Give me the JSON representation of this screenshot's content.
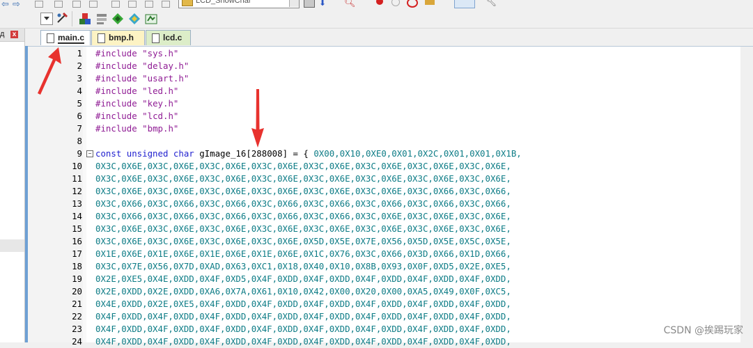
{
  "toolbar": {
    "target_name": "LCD_ShowChar"
  },
  "left_panel": {
    "title": "д",
    "close_glyph": "x"
  },
  "tabs": [
    {
      "label": "main.c"
    },
    {
      "label": "bmp.h"
    },
    {
      "label": "lcd.c"
    }
  ],
  "editor": {
    "lines": [
      {
        "n": "1",
        "pre": "#include",
        "str": "\"sys.h\""
      },
      {
        "n": "2",
        "pre": "#include",
        "str": "\"delay.h\""
      },
      {
        "n": "3",
        "pre": "#include",
        "str": "\"usart.h\""
      },
      {
        "n": "4",
        "pre": "#include",
        "str": "\"led.h\""
      },
      {
        "n": "5",
        "pre": "#include",
        "str": "\"key.h\""
      },
      {
        "n": "6",
        "pre": "#include",
        "str": "\"lcd.h\""
      },
      {
        "n": "7",
        "pre": "#include",
        "str": "\"bmp.h\""
      },
      {
        "n": "8"
      },
      {
        "n": "9",
        "kw": "const unsigned char",
        "decl": "gImage_16[288008] = {",
        "hex": "0X00,0X10,0XE0,0X01,0X2C,0X01,0X01,0X1B,"
      },
      {
        "n": "10",
        "hex": "0X3C,0X6E,0X3C,0X6E,0X3C,0X6E,0X3C,0X6E,0X3C,0X6E,0X3C,0X6E,0X3C,0X6E,0X3C,0X6E,"
      },
      {
        "n": "11",
        "hex": "0X3C,0X6E,0X3C,0X6E,0X3C,0X6E,0X3C,0X6E,0X3C,0X6E,0X3C,0X6E,0X3C,0X6E,0X3C,0X6E,"
      },
      {
        "n": "12",
        "hex": "0X3C,0X6E,0X3C,0X6E,0X3C,0X6E,0X3C,0X6E,0X3C,0X6E,0X3C,0X6E,0X3C,0X66,0X3C,0X66,"
      },
      {
        "n": "13",
        "hex": "0X3C,0X66,0X3C,0X66,0X3C,0X66,0X3C,0X66,0X3C,0X66,0X3C,0X66,0X3C,0X66,0X3C,0X66,"
      },
      {
        "n": "14",
        "hex": "0X3C,0X66,0X3C,0X66,0X3C,0X66,0X3C,0X66,0X3C,0X66,0X3C,0X6E,0X3C,0X6E,0X3C,0X6E,"
      },
      {
        "n": "15",
        "hex": "0X3C,0X6E,0X3C,0X6E,0X3C,0X6E,0X3C,0X6E,0X3C,0X6E,0X3C,0X6E,0X3C,0X6E,0X3C,0X6E,"
      },
      {
        "n": "16",
        "hex": "0X3C,0X6E,0X3C,0X6E,0X3C,0X6E,0X3C,0X6E,0X5D,0X5E,0X7E,0X56,0X5D,0X5E,0X5C,0X5E,"
      },
      {
        "n": "17",
        "hex": "0X1E,0X6E,0X1E,0X6E,0X1E,0X6E,0X1E,0X6E,0X1C,0X76,0X3C,0X66,0X3D,0X66,0X1D,0X66,"
      },
      {
        "n": "18",
        "hex": "0X3C,0X7E,0X56,0X7D,0XAD,0X63,0XC1,0X18,0X40,0X10,0X8B,0X93,0X0F,0XD5,0X2E,0XE5,"
      },
      {
        "n": "19",
        "hex": "0X2E,0XE5,0X4E,0XDD,0X4F,0XD5,0X4F,0XDD,0X4F,0XDD,0X4F,0XDD,0X4F,0XDD,0X4F,0XDD,"
      },
      {
        "n": "20",
        "hex": "0X2E,0XDD,0X2E,0XDD,0XA6,0X7A,0X61,0X10,0X42,0X00,0X20,0X00,0XA5,0X49,0X0F,0XC5,"
      },
      {
        "n": "21",
        "hex": "0X4E,0XDD,0X2E,0XE5,0X4F,0XDD,0X4F,0XDD,0X4F,0XDD,0X4F,0XDD,0X4F,0XDD,0X4F,0XDD,"
      },
      {
        "n": "22",
        "hex": "0X4F,0XDD,0X4F,0XDD,0X4F,0XDD,0X4F,0XDD,0X4F,0XDD,0X4F,0XDD,0X4F,0XDD,0X4F,0XDD,"
      },
      {
        "n": "23",
        "hex": "0X4F,0XDD,0X4F,0XDD,0X4F,0XDD,0X4F,0XDD,0X4F,0XDD,0X4F,0XDD,0X4F,0XDD,0X4F,0XDD,"
      },
      {
        "n": "24",
        "hex": "0X4F,0XDD,0X4F,0XDD,0X4F,0XDD,0X4F,0XDD,0X4F,0XDD,0X4F,0XDD,0X4F,0XDD,0X4F,0XDD,"
      }
    ]
  },
  "watermark": "CSDN @挨踢玩家",
  "colors": {
    "preprocessor": "#8f1b94",
    "keyword": "#1f1fcf",
    "hex_literal": "#0d7c86",
    "annotation_arrow": "#e8322e"
  }
}
